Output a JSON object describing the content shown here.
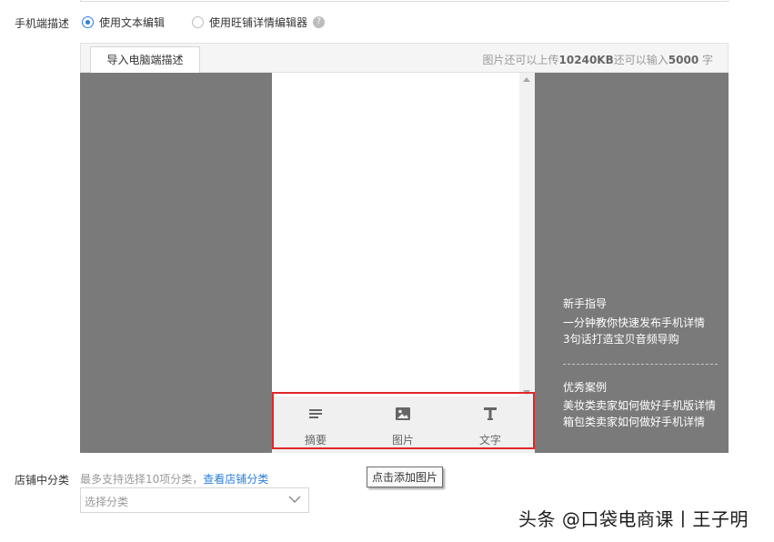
{
  "mobile_desc": {
    "label": "手机端描述",
    "option_text_editor": "使用文本编辑",
    "option_wangpu_editor": "使用旺铺详情编辑器",
    "selected": "使用文本编辑"
  },
  "editor": {
    "import_button": "导入电脑端描述",
    "quota_prefix": "图片还可以上传",
    "quota_size": "10240KB",
    "quota_middle": "还可以输入",
    "quota_chars": "5000",
    "quota_suffix": " 字",
    "tools": [
      {
        "icon": "summary-icon",
        "label": "摘要"
      },
      {
        "icon": "image-icon",
        "label": "图片"
      },
      {
        "icon": "text-icon",
        "label": "文字"
      }
    ],
    "highlight_color": "#e0282a"
  },
  "side_panel": {
    "guide_title": "新手指导",
    "guide_links": [
      "一分钟教你快速发布手机详情",
      "3句话打造宝贝音频导购"
    ],
    "cases_title": "优秀案例",
    "case_links": [
      "美妆类卖家如何做好手机版详情",
      "箱包类卖家如何做好手机详情"
    ]
  },
  "shop_category": {
    "label": "店铺中分类",
    "hint": "最多支持选择10项分类，",
    "hint_link": "查看店铺分类",
    "select_placeholder": "选择分类"
  },
  "tooltip": "点击添加图片",
  "watermark": "头条 @口袋电商课丨王子明",
  "colors": {
    "accent": "#2b7fd9",
    "editor_bg": "#7a7a7a"
  }
}
